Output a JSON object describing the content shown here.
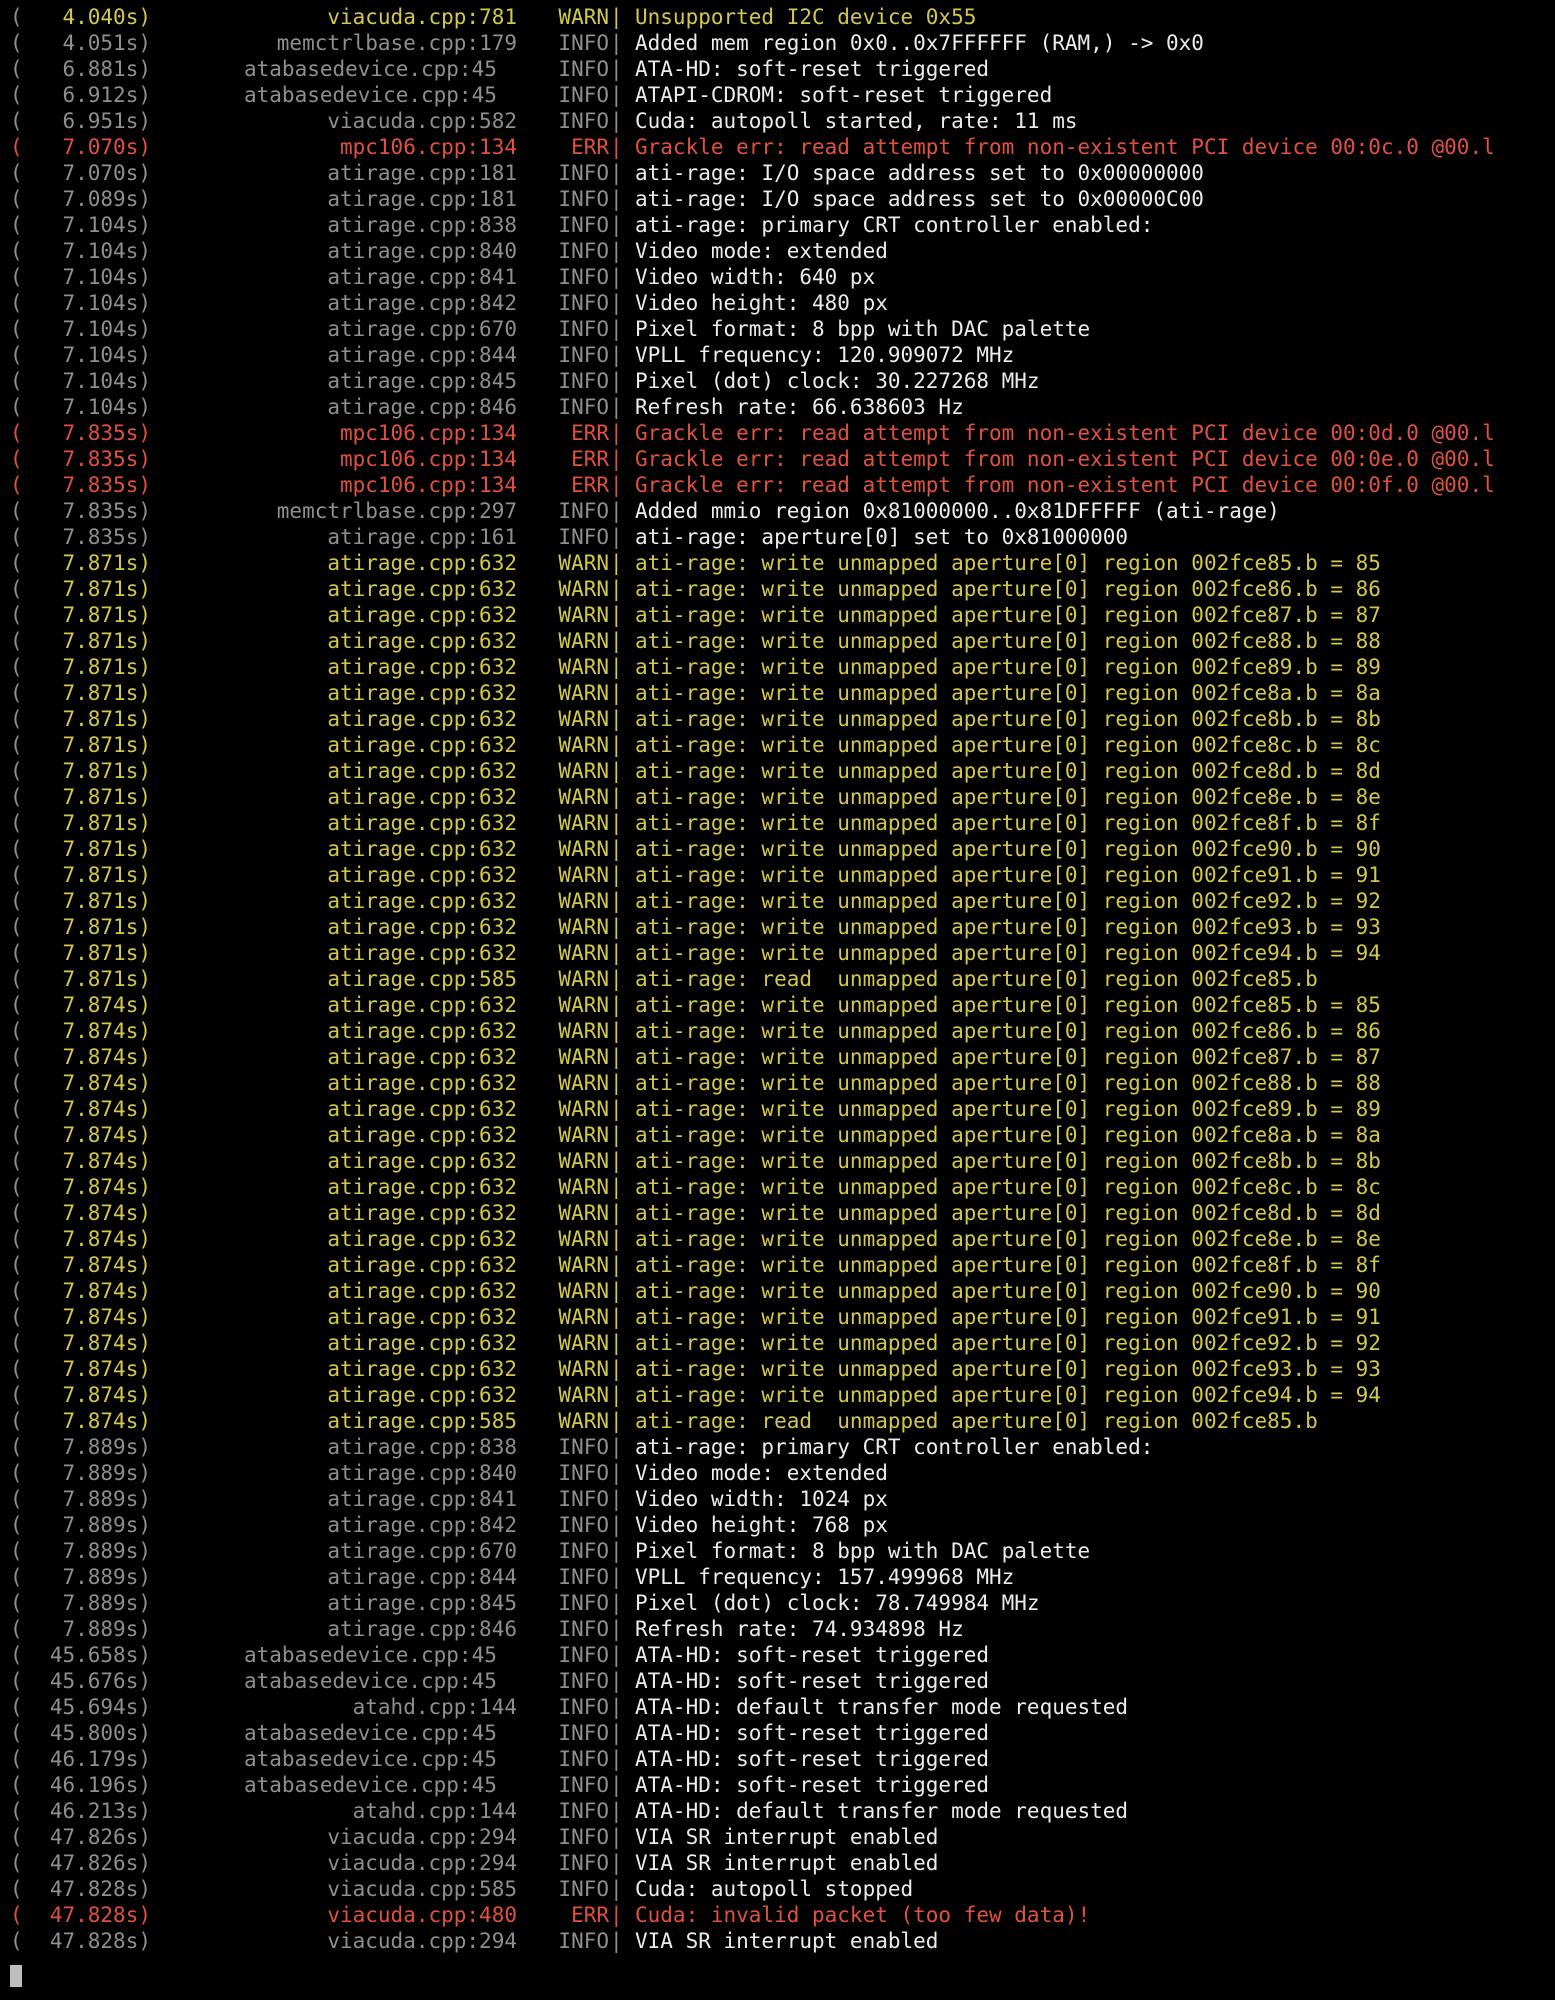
{
  "terminal": {
    "colors": {
      "background": "#000000",
      "info_text": "#ececec",
      "dim_text": "#8f8f8f",
      "warn": "#d3c84e",
      "err": "#e0523e"
    },
    "lines": [
      {
        "ts": "4.040s)",
        "src": "viacuda.cpp:781",
        "level": "WARN",
        "msg": "Unsupported I2C device 0x55"
      },
      {
        "ts": "4.051s)",
        "src": "memctrlbase.cpp:179",
        "level": "INFO",
        "msg": "Added mem region 0x0..0x7FFFFFF (RAM,) -> 0x0"
      },
      {
        "ts": "6.881s)",
        "src": "atabasedevice.cpp:45",
        "level": "INFO",
        "msg": "ATA-HD: soft-reset triggered"
      },
      {
        "ts": "6.912s)",
        "src": "atabasedevice.cpp:45",
        "level": "INFO",
        "msg": "ATAPI-CDROM: soft-reset triggered"
      },
      {
        "ts": "6.951s)",
        "src": "viacuda.cpp:582",
        "level": "INFO",
        "msg": "Cuda: autopoll started, rate: 11 ms"
      },
      {
        "ts": "7.070s)",
        "src": "mpc106.cpp:134",
        "level": "ERR",
        "msg": "Grackle err: read attempt from non-existent PCI device 00:0c.0 @00.l"
      },
      {
        "ts": "7.070s)",
        "src": "atirage.cpp:181",
        "level": "INFO",
        "msg": "ati-rage: I/O space address set to 0x00000000"
      },
      {
        "ts": "7.089s)",
        "src": "atirage.cpp:181",
        "level": "INFO",
        "msg": "ati-rage: I/O space address set to 0x00000C00"
      },
      {
        "ts": "7.104s)",
        "src": "atirage.cpp:838",
        "level": "INFO",
        "msg": "ati-rage: primary CRT controller enabled:"
      },
      {
        "ts": "7.104s)",
        "src": "atirage.cpp:840",
        "level": "INFO",
        "msg": "Video mode: extended"
      },
      {
        "ts": "7.104s)",
        "src": "atirage.cpp:841",
        "level": "INFO",
        "msg": "Video width: 640 px"
      },
      {
        "ts": "7.104s)",
        "src": "atirage.cpp:842",
        "level": "INFO",
        "msg": "Video height: 480 px"
      },
      {
        "ts": "7.104s)",
        "src": "atirage.cpp:670",
        "level": "INFO",
        "msg": "Pixel format: 8 bpp with DAC palette"
      },
      {
        "ts": "7.104s)",
        "src": "atirage.cpp:844",
        "level": "INFO",
        "msg": "VPLL frequency: 120.909072 MHz"
      },
      {
        "ts": "7.104s)",
        "src": "atirage.cpp:845",
        "level": "INFO",
        "msg": "Pixel (dot) clock: 30.227268 MHz"
      },
      {
        "ts": "7.104s)",
        "src": "atirage.cpp:846",
        "level": "INFO",
        "msg": "Refresh rate: 66.638603 Hz"
      },
      {
        "ts": "7.835s)",
        "src": "mpc106.cpp:134",
        "level": "ERR",
        "msg": "Grackle err: read attempt from non-existent PCI device 00:0d.0 @00.l"
      },
      {
        "ts": "7.835s)",
        "src": "mpc106.cpp:134",
        "level": "ERR",
        "msg": "Grackle err: read attempt from non-existent PCI device 00:0e.0 @00.l"
      },
      {
        "ts": "7.835s)",
        "src": "mpc106.cpp:134",
        "level": "ERR",
        "msg": "Grackle err: read attempt from non-existent PCI device 00:0f.0 @00.l"
      },
      {
        "ts": "7.835s)",
        "src": "memctrlbase.cpp:297",
        "level": "INFO",
        "msg": "Added mmio region 0x81000000..0x81DFFFFF (ati-rage)"
      },
      {
        "ts": "7.835s)",
        "src": "atirage.cpp:161",
        "level": "INFO",
        "msg": "ati-rage: aperture[0] set to 0x81000000"
      },
      {
        "ts": "7.871s)",
        "src": "atirage.cpp:632",
        "level": "WARN",
        "msg": "ati-rage: write unmapped aperture[0] region 002fce85.b = 85"
      },
      {
        "ts": "7.871s)",
        "src": "atirage.cpp:632",
        "level": "WARN",
        "msg": "ati-rage: write unmapped aperture[0] region 002fce86.b = 86"
      },
      {
        "ts": "7.871s)",
        "src": "atirage.cpp:632",
        "level": "WARN",
        "msg": "ati-rage: write unmapped aperture[0] region 002fce87.b = 87"
      },
      {
        "ts": "7.871s)",
        "src": "atirage.cpp:632",
        "level": "WARN",
        "msg": "ati-rage: write unmapped aperture[0] region 002fce88.b = 88"
      },
      {
        "ts": "7.871s)",
        "src": "atirage.cpp:632",
        "level": "WARN",
        "msg": "ati-rage: write unmapped aperture[0] region 002fce89.b = 89"
      },
      {
        "ts": "7.871s)",
        "src": "atirage.cpp:632",
        "level": "WARN",
        "msg": "ati-rage: write unmapped aperture[0] region 002fce8a.b = 8a"
      },
      {
        "ts": "7.871s)",
        "src": "atirage.cpp:632",
        "level": "WARN",
        "msg": "ati-rage: write unmapped aperture[0] region 002fce8b.b = 8b"
      },
      {
        "ts": "7.871s)",
        "src": "atirage.cpp:632",
        "level": "WARN",
        "msg": "ati-rage: write unmapped aperture[0] region 002fce8c.b = 8c"
      },
      {
        "ts": "7.871s)",
        "src": "atirage.cpp:632",
        "level": "WARN",
        "msg": "ati-rage: write unmapped aperture[0] region 002fce8d.b = 8d"
      },
      {
        "ts": "7.871s)",
        "src": "atirage.cpp:632",
        "level": "WARN",
        "msg": "ati-rage: write unmapped aperture[0] region 002fce8e.b = 8e"
      },
      {
        "ts": "7.871s)",
        "src": "atirage.cpp:632",
        "level": "WARN",
        "msg": "ati-rage: write unmapped aperture[0] region 002fce8f.b = 8f"
      },
      {
        "ts": "7.871s)",
        "src": "atirage.cpp:632",
        "level": "WARN",
        "msg": "ati-rage: write unmapped aperture[0] region 002fce90.b = 90"
      },
      {
        "ts": "7.871s)",
        "src": "atirage.cpp:632",
        "level": "WARN",
        "msg": "ati-rage: write unmapped aperture[0] region 002fce91.b = 91"
      },
      {
        "ts": "7.871s)",
        "src": "atirage.cpp:632",
        "level": "WARN",
        "msg": "ati-rage: write unmapped aperture[0] region 002fce92.b = 92"
      },
      {
        "ts": "7.871s)",
        "src": "atirage.cpp:632",
        "level": "WARN",
        "msg": "ati-rage: write unmapped aperture[0] region 002fce93.b = 93"
      },
      {
        "ts": "7.871s)",
        "src": "atirage.cpp:632",
        "level": "WARN",
        "msg": "ati-rage: write unmapped aperture[0] region 002fce94.b = 94"
      },
      {
        "ts": "7.871s)",
        "src": "atirage.cpp:585",
        "level": "WARN",
        "msg": "ati-rage: read  unmapped aperture[0] region 002fce85.b"
      },
      {
        "ts": "7.874s)",
        "src": "atirage.cpp:632",
        "level": "WARN",
        "msg": "ati-rage: write unmapped aperture[0] region 002fce85.b = 85"
      },
      {
        "ts": "7.874s)",
        "src": "atirage.cpp:632",
        "level": "WARN",
        "msg": "ati-rage: write unmapped aperture[0] region 002fce86.b = 86"
      },
      {
        "ts": "7.874s)",
        "src": "atirage.cpp:632",
        "level": "WARN",
        "msg": "ati-rage: write unmapped aperture[0] region 002fce87.b = 87"
      },
      {
        "ts": "7.874s)",
        "src": "atirage.cpp:632",
        "level": "WARN",
        "msg": "ati-rage: write unmapped aperture[0] region 002fce88.b = 88"
      },
      {
        "ts": "7.874s)",
        "src": "atirage.cpp:632",
        "level": "WARN",
        "msg": "ati-rage: write unmapped aperture[0] region 002fce89.b = 89"
      },
      {
        "ts": "7.874s)",
        "src": "atirage.cpp:632",
        "level": "WARN",
        "msg": "ati-rage: write unmapped aperture[0] region 002fce8a.b = 8a"
      },
      {
        "ts": "7.874s)",
        "src": "atirage.cpp:632",
        "level": "WARN",
        "msg": "ati-rage: write unmapped aperture[0] region 002fce8b.b = 8b"
      },
      {
        "ts": "7.874s)",
        "src": "atirage.cpp:632",
        "level": "WARN",
        "msg": "ati-rage: write unmapped aperture[0] region 002fce8c.b = 8c"
      },
      {
        "ts": "7.874s)",
        "src": "atirage.cpp:632",
        "level": "WARN",
        "msg": "ati-rage: write unmapped aperture[0] region 002fce8d.b = 8d"
      },
      {
        "ts": "7.874s)",
        "src": "atirage.cpp:632",
        "level": "WARN",
        "msg": "ati-rage: write unmapped aperture[0] region 002fce8e.b = 8e"
      },
      {
        "ts": "7.874s)",
        "src": "atirage.cpp:632",
        "level": "WARN",
        "msg": "ati-rage: write unmapped aperture[0] region 002fce8f.b = 8f"
      },
      {
        "ts": "7.874s)",
        "src": "atirage.cpp:632",
        "level": "WARN",
        "msg": "ati-rage: write unmapped aperture[0] region 002fce90.b = 90"
      },
      {
        "ts": "7.874s)",
        "src": "atirage.cpp:632",
        "level": "WARN",
        "msg": "ati-rage: write unmapped aperture[0] region 002fce91.b = 91"
      },
      {
        "ts": "7.874s)",
        "src": "atirage.cpp:632",
        "level": "WARN",
        "msg": "ati-rage: write unmapped aperture[0] region 002fce92.b = 92"
      },
      {
        "ts": "7.874s)",
        "src": "atirage.cpp:632",
        "level": "WARN",
        "msg": "ati-rage: write unmapped aperture[0] region 002fce93.b = 93"
      },
      {
        "ts": "7.874s)",
        "src": "atirage.cpp:632",
        "level": "WARN",
        "msg": "ati-rage: write unmapped aperture[0] region 002fce94.b = 94"
      },
      {
        "ts": "7.874s)",
        "src": "atirage.cpp:585",
        "level": "WARN",
        "msg": "ati-rage: read  unmapped aperture[0] region 002fce85.b"
      },
      {
        "ts": "7.889s)",
        "src": "atirage.cpp:838",
        "level": "INFO",
        "msg": "ati-rage: primary CRT controller enabled:"
      },
      {
        "ts": "7.889s)",
        "src": "atirage.cpp:840",
        "level": "INFO",
        "msg": "Video mode: extended"
      },
      {
        "ts": "7.889s)",
        "src": "atirage.cpp:841",
        "level": "INFO",
        "msg": "Video width: 1024 px"
      },
      {
        "ts": "7.889s)",
        "src": "atirage.cpp:842",
        "level": "INFO",
        "msg": "Video height: 768 px"
      },
      {
        "ts": "7.889s)",
        "src": "atirage.cpp:670",
        "level": "INFO",
        "msg": "Pixel format: 8 bpp with DAC palette"
      },
      {
        "ts": "7.889s)",
        "src": "atirage.cpp:844",
        "level": "INFO",
        "msg": "VPLL frequency: 157.499968 MHz"
      },
      {
        "ts": "7.889s)",
        "src": "atirage.cpp:845",
        "level": "INFO",
        "msg": "Pixel (dot) clock: 78.749984 MHz"
      },
      {
        "ts": "7.889s)",
        "src": "atirage.cpp:846",
        "level": "INFO",
        "msg": "Refresh rate: 74.934898 Hz"
      },
      {
        "ts": "45.658s)",
        "src": "atabasedevice.cpp:45",
        "level": "INFO",
        "msg": "ATA-HD: soft-reset triggered"
      },
      {
        "ts": "45.676s)",
        "src": "atabasedevice.cpp:45",
        "level": "INFO",
        "msg": "ATA-HD: soft-reset triggered"
      },
      {
        "ts": "45.694s)",
        "src": "atahd.cpp:144",
        "level": "INFO",
        "msg": "ATA-HD: default transfer mode requested"
      },
      {
        "ts": "45.800s)",
        "src": "atabasedevice.cpp:45",
        "level": "INFO",
        "msg": "ATA-HD: soft-reset triggered"
      },
      {
        "ts": "46.179s)",
        "src": "atabasedevice.cpp:45",
        "level": "INFO",
        "msg": "ATA-HD: soft-reset triggered"
      },
      {
        "ts": "46.196s)",
        "src": "atabasedevice.cpp:45",
        "level": "INFO",
        "msg": "ATA-HD: soft-reset triggered"
      },
      {
        "ts": "46.213s)",
        "src": "atahd.cpp:144",
        "level": "INFO",
        "msg": "ATA-HD: default transfer mode requested"
      },
      {
        "ts": "47.826s)",
        "src": "viacuda.cpp:294",
        "level": "INFO",
        "msg": "VIA SR interrupt enabled"
      },
      {
        "ts": "47.826s)",
        "src": "viacuda.cpp:294",
        "level": "INFO",
        "msg": "VIA SR interrupt enabled"
      },
      {
        "ts": "47.828s)",
        "src": "viacuda.cpp:585",
        "level": "INFO",
        "msg": "Cuda: autopoll stopped"
      },
      {
        "ts": "47.828s)",
        "src": "viacuda.cpp:480",
        "level": "ERR",
        "msg": "Cuda: invalid packet (too few data)!"
      },
      {
        "ts": "47.828s)",
        "src": "viacuda.cpp:294",
        "level": "INFO",
        "msg": "VIA SR interrupt enabled"
      }
    ]
  }
}
